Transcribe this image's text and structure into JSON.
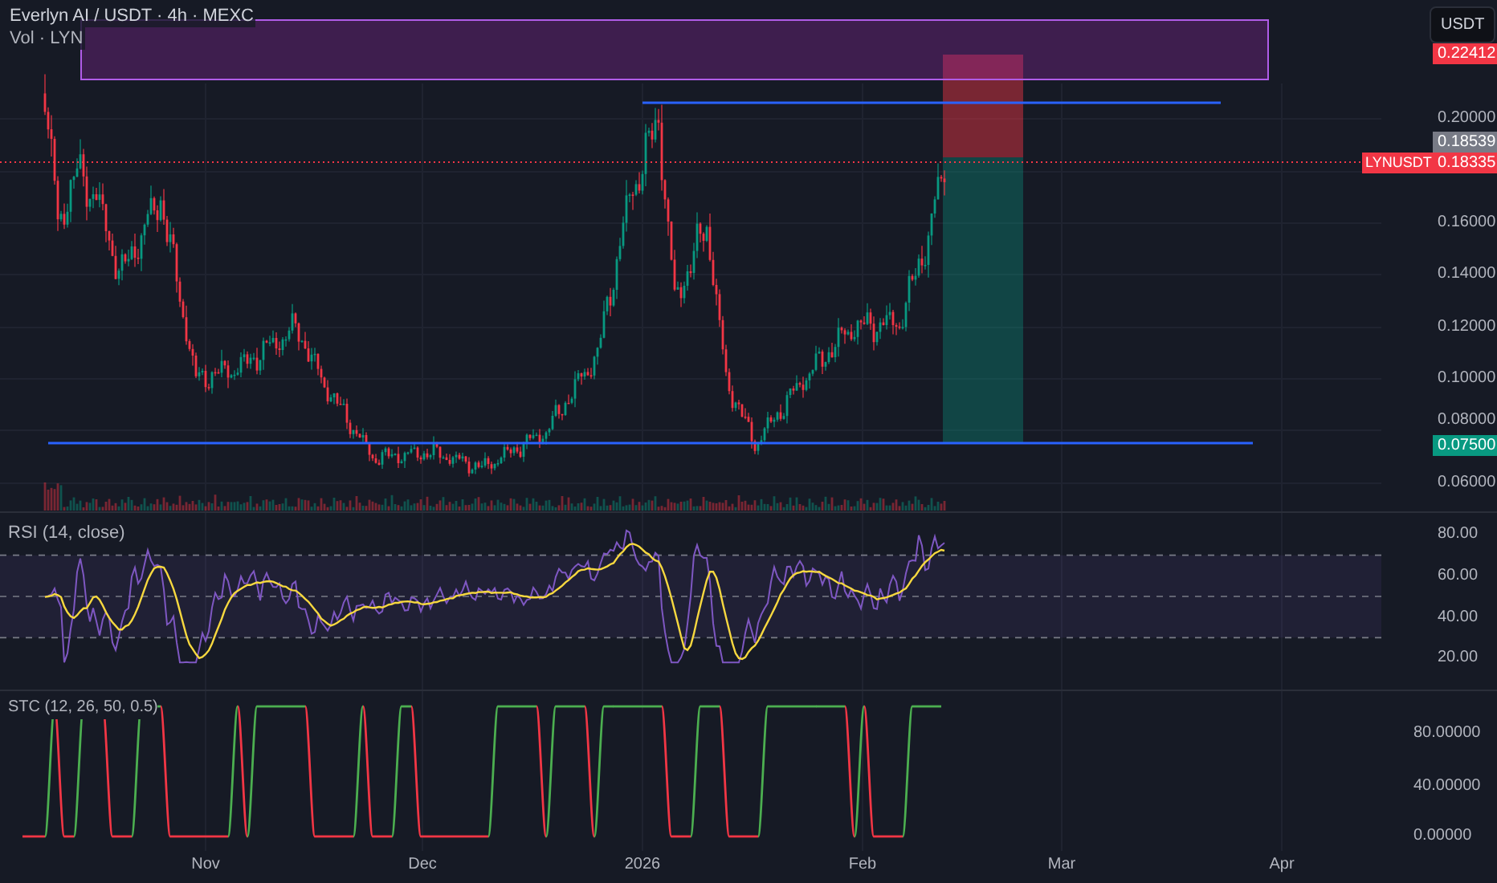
{
  "header": {
    "title": "Everlyn AI / USDT · 4h · MEXC",
    "volume_label": "Vol · LYN"
  },
  "currency_button": "USDT",
  "price_axis": {
    "ticks": [
      "0.20000",
      "0.16000",
      "0.14000",
      "0.12000",
      "0.10000",
      "0.08000",
      "0.06000"
    ]
  },
  "price_labels": [
    {
      "kind": "alert",
      "text": "0.22412"
    },
    {
      "kind": "high",
      "text": "0.18539"
    },
    {
      "kind": "last",
      "symbol": "LYNUSDT",
      "text": "0.18335"
    },
    {
      "kind": "target",
      "text": "0.07500"
    }
  ],
  "rsi": {
    "title": "RSI (14, close)",
    "ticks": [
      "80.00",
      "60.00",
      "40.00",
      "20.00"
    ]
  },
  "stc": {
    "title": "STC (12, 26, 50, 0.5)",
    "ticks": [
      "80.00000",
      "40.00000",
      "0.00000"
    ]
  },
  "time_axis": [
    "Nov",
    "Dec",
    "2026",
    "Feb",
    "Mar",
    "Apr"
  ]
}
